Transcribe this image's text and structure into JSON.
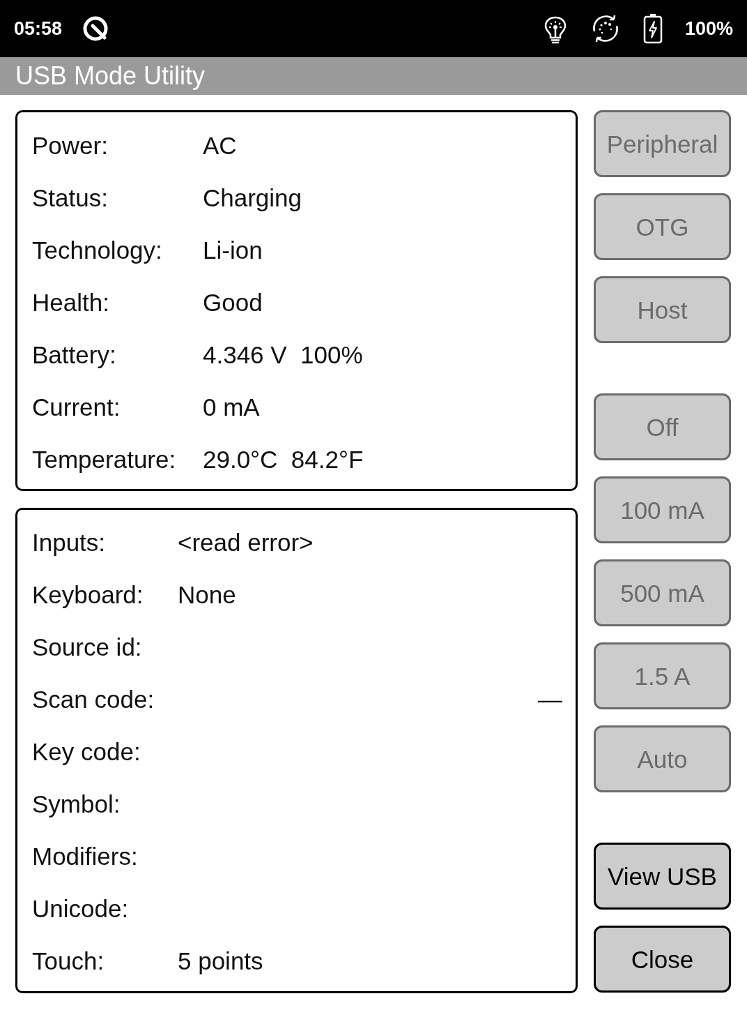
{
  "status_bar": {
    "time": "05:58",
    "battery_text": "100%"
  },
  "title": "USB Mode Utility",
  "panels": [
    {
      "kind": "battery",
      "rows": [
        {
          "label": "Power:",
          "value": "AC"
        },
        {
          "label": "Status:",
          "value": "Charging"
        },
        {
          "label": "Technology:",
          "value": "Li-ion"
        },
        {
          "label": "Health:",
          "value": "Good"
        },
        {
          "label": "Battery:",
          "value": "4.346 V  100%"
        },
        {
          "label": "Current:",
          "value": "0 mA"
        },
        {
          "label": "Temperature:",
          "value": "29.0°C  84.2°F"
        }
      ]
    },
    {
      "kind": "input",
      "rows": [
        {
          "label": "Inputs:",
          "value": "<read error>"
        },
        {
          "label": "Keyboard:",
          "value": "None"
        },
        {
          "label": "Source id:"
        },
        {
          "label": "Scan code:",
          "trailing": "—"
        },
        {
          "label": "Key code:"
        },
        {
          "label": "Symbol:"
        },
        {
          "label": "Modifiers:"
        },
        {
          "label": "Unicode:"
        },
        {
          "label": "Touch:",
          "value": "5 points"
        }
      ]
    }
  ],
  "button_groups": [
    [
      {
        "label": "Peripheral",
        "disabled": true
      },
      {
        "label": "OTG",
        "disabled": true
      },
      {
        "label": "Host",
        "disabled": true
      }
    ],
    [
      {
        "label": "Off",
        "disabled": true
      },
      {
        "label": "100 mA",
        "disabled": true
      },
      {
        "label": "500 mA",
        "disabled": true
      },
      {
        "label": "1.5 A",
        "disabled": true
      },
      {
        "label": "Auto",
        "disabled": true
      }
    ],
    [
      {
        "label": "View USB",
        "disabled": false
      },
      {
        "label": "Close",
        "disabled": false
      }
    ]
  ]
}
